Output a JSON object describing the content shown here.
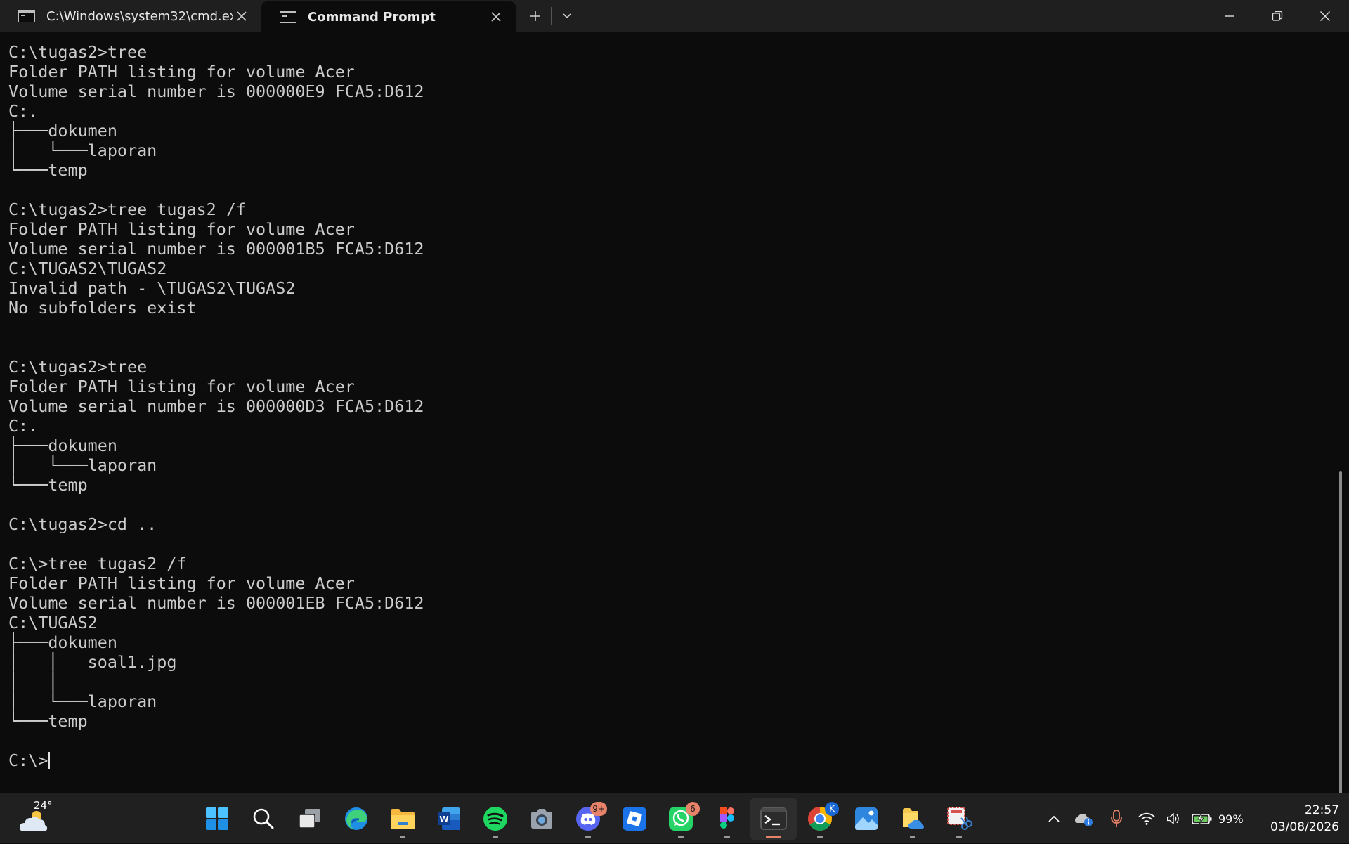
{
  "window": {
    "tabs": [
      {
        "title": "C:\\Windows\\system32\\cmd.ex",
        "icon": "terminal-icon",
        "active": false
      },
      {
        "title": "Command Prompt",
        "icon": "terminal-icon",
        "active": true
      }
    ],
    "new_tab_label": "+",
    "dropdown_label": "⌄",
    "controls": {
      "minimize": "—",
      "maximize": "❐",
      "close": "✕"
    }
  },
  "console": {
    "lines": [
      "C:\\tugas2>tree",
      "Folder PATH listing for volume Acer",
      "Volume serial number is 000000E9 FCA5:D612",
      "C:.",
      "├───dokumen",
      "│   └───laporan",
      "└───temp",
      "",
      "C:\\tugas2>tree tugas2 /f",
      "Folder PATH listing for volume Acer",
      "Volume serial number is 000001B5 FCA5:D612",
      "C:\\TUGAS2\\TUGAS2",
      "Invalid path - \\TUGAS2\\TUGAS2",
      "No subfolders exist",
      "",
      "",
      "C:\\tugas2>tree",
      "Folder PATH listing for volume Acer",
      "Volume serial number is 000000D3 FCA5:D612",
      "C:.",
      "├───dokumen",
      "│   └───laporan",
      "└───temp",
      "",
      "C:\\tugas2>cd ..",
      "",
      "C:\\>tree tugas2 /f",
      "Folder PATH listing for volume Acer",
      "Volume serial number is 000001EB FCA5:D612",
      "C:\\TUGAS2",
      "├───dokumen",
      "│   │   soal1.jpg",
      "│   │",
      "│   └───laporan",
      "└───temp",
      ""
    ],
    "prompt": "C:\\>"
  },
  "taskbar": {
    "weather_temp": "24°",
    "apps": [
      {
        "name": "start-icon",
        "badge": ""
      },
      {
        "name": "search-icon",
        "badge": ""
      },
      {
        "name": "task-view-icon",
        "badge": ""
      },
      {
        "name": "edge-icon",
        "badge": ""
      },
      {
        "name": "file-explorer-icon",
        "badge": ""
      },
      {
        "name": "word-icon",
        "badge": ""
      },
      {
        "name": "spotify-icon",
        "badge": ""
      },
      {
        "name": "camera-icon",
        "badge": ""
      },
      {
        "name": "discord-icon",
        "badge": "9+"
      },
      {
        "name": "roblox-icon",
        "badge": ""
      },
      {
        "name": "whatsapp-icon",
        "badge": "6"
      },
      {
        "name": "figma-icon",
        "badge": ""
      },
      {
        "name": "terminal-icon",
        "badge": ""
      },
      {
        "name": "chrome-icon",
        "badge": "K"
      },
      {
        "name": "photos-icon",
        "badge": ""
      },
      {
        "name": "folder-cloud-icon",
        "badge": ""
      },
      {
        "name": "snipping-tool-icon",
        "badge": ""
      }
    ],
    "battery": "99%",
    "time": "22:57",
    "date": "03/08/2026"
  },
  "colors": {
    "console_bg": "#0c0c0c",
    "console_text": "#cccccc",
    "titlebar_bg": "#1f1f1f",
    "taskbar_bg": "#202020",
    "badge": "#e8836a"
  }
}
